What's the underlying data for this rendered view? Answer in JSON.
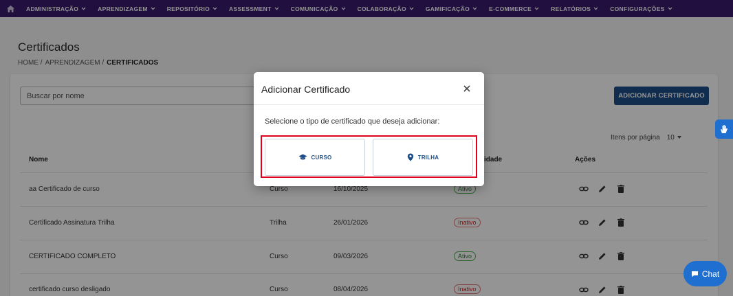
{
  "nav": {
    "items": [
      {
        "label": "ADMINISTRAÇÃO"
      },
      {
        "label": "APRENDIZAGEM"
      },
      {
        "label": "REPOSITÓRIO"
      },
      {
        "label": "ASSESSMENT"
      },
      {
        "label": "COMUNICAÇÃO"
      },
      {
        "label": "COLABORAÇÃO"
      },
      {
        "label": "GAMIFICAÇÃO"
      },
      {
        "label": "E-COMMERCE"
      },
      {
        "label": "RELATÓRIOS"
      },
      {
        "label": "CONFIGURAÇÕES"
      }
    ]
  },
  "page": {
    "title": "Certificados",
    "breadcrumb": [
      "HOME /",
      "APRENDIZAGEM /",
      "CERTIFICADOS"
    ]
  },
  "search": {
    "placeholder": "Buscar por nome"
  },
  "toolbar": {
    "add_label": "ADICIONAR CERTIFICADO"
  },
  "pager": {
    "label": "Itens por página",
    "value": "10"
  },
  "table": {
    "headers": {
      "name": "Nome",
      "status_partial": "idade",
      "actions": "Ações"
    },
    "rows": [
      {
        "name": "aa Certificado de curso",
        "type": "Curso",
        "date": "16/10/2025",
        "status": "Ativo"
      },
      {
        "name": "Certificado Assinatura Trilha",
        "type": "Trilha",
        "date": "26/01/2026",
        "status": "Inativo"
      },
      {
        "name": "CERTIFICADO COMPLETO",
        "type": "Curso",
        "date": "09/03/2026",
        "status": "Ativo"
      },
      {
        "name": "certificado curso desligado",
        "type": "Curso",
        "date": "08/04/2026",
        "status": "Inativo"
      }
    ]
  },
  "modal": {
    "title": "Adicionar Certificado",
    "prompt": "Selecione o tipo de certificado que deseja adicionar:",
    "options": [
      {
        "label": "CURSO",
        "icon": "graduation-cap-icon"
      },
      {
        "label": "TRILHA",
        "icon": "map-pin-icon"
      }
    ]
  },
  "chat": {
    "label": "Chat"
  },
  "colors": {
    "nav_bg": "#3a1a6e",
    "primary": "#1d4e89",
    "highlight": "#e0001b",
    "widget": "#1e6fd0"
  }
}
